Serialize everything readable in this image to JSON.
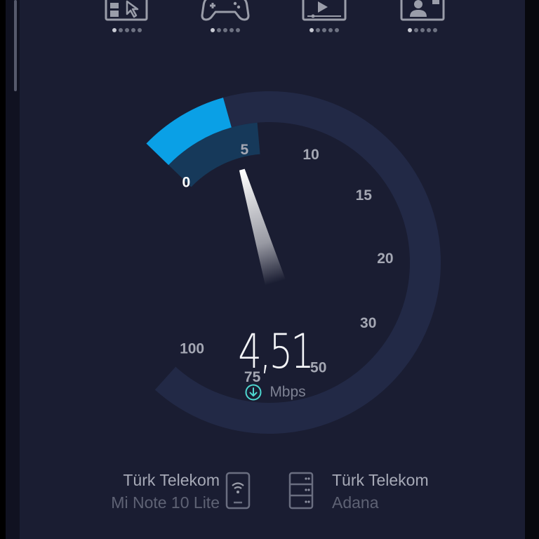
{
  "mode_buttons": [
    {
      "name": "browsing",
      "icon": "browsing-cursor-icon",
      "active_dot": 0
    },
    {
      "name": "gaming",
      "icon": "gamepad-icon",
      "active_dot": 0
    },
    {
      "name": "streaming",
      "icon": "video-play-icon",
      "active_dot": 0
    },
    {
      "name": "video-call",
      "icon": "video-call-person-icon",
      "active_dot": 0
    }
  ],
  "gauge": {
    "ticks": [
      "0",
      "5",
      "10",
      "15",
      "20",
      "30",
      "50",
      "75",
      "100"
    ],
    "tick_values": [
      0,
      5,
      10,
      15,
      20,
      30,
      50,
      75,
      100
    ],
    "current_speed": 4.51,
    "fill_fraction": 0.113,
    "needle_fraction": 0.11
  },
  "speed": {
    "value": "4,51",
    "unit": "Mbps",
    "direction_icon": "download-arrow-icon"
  },
  "provider": {
    "name": "Türk Telekom",
    "device": "Mi Note 10 Lite",
    "icon": "phone-wifi-icon"
  },
  "server": {
    "name": "Türk Telekom",
    "location": "Adana",
    "icon": "server-icon"
  },
  "colors": {
    "background": "#1a1d32",
    "gauge_track": "#222946",
    "gauge_fill": "#0aa0e6",
    "tick_active": "#ffffff",
    "tick_inactive": "#a4a7b3",
    "accent_teal": "#4ed7d0"
  }
}
